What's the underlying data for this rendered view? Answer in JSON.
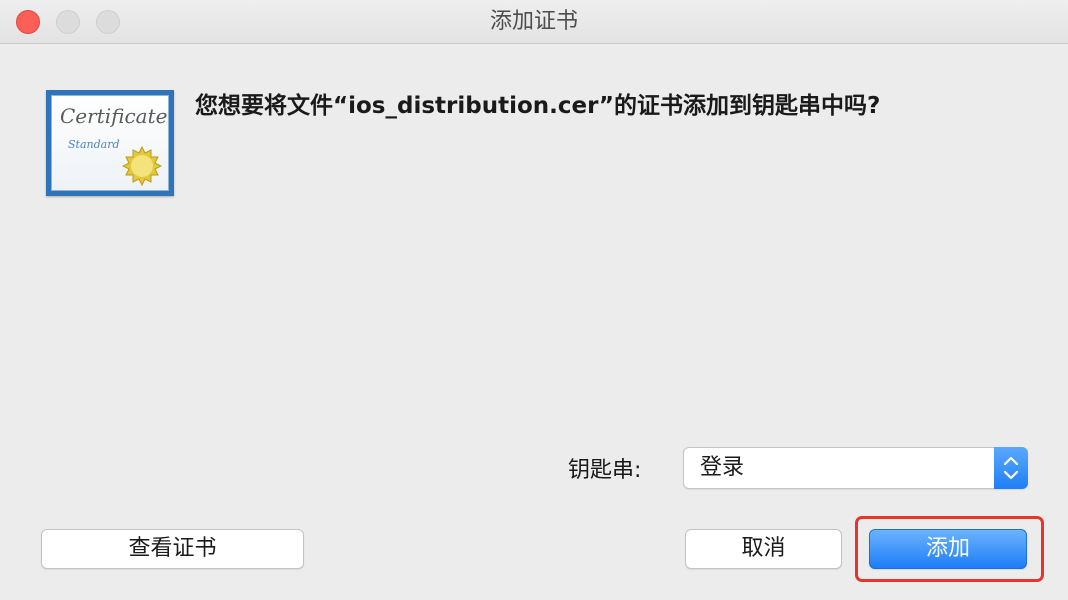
{
  "window": {
    "title": "添加证书"
  },
  "certificate_icon": {
    "title": "Certificate",
    "subtitle": "Standard"
  },
  "message": "您想要将文件“ios_distribution.cer”的证书添加到钥匙串中吗?",
  "keychain": {
    "label": "钥匙串:",
    "selected": "登录"
  },
  "buttons": {
    "view_certificate": "查看证书",
    "cancel": "取消",
    "add": "添加"
  },
  "colors": {
    "close_button": "#fc5f57",
    "primary_button": "#1d7df6",
    "highlight_border": "#e8352b"
  }
}
